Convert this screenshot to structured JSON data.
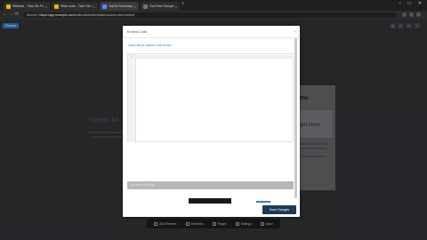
{
  "browser": {
    "tabs": [
      {
        "title": "Webinar - Twin Six Fu...",
        "color": "#f4b400",
        "active": false
      },
      {
        "title": "Slide code - Twin Six Fu...",
        "color": "#f4b400",
        "active": false
      },
      {
        "title": "TopTal Summary",
        "color": "#4a8cff",
        "active": true
      },
      {
        "title": "Our Free Sample HTML...",
        "color": "#777777",
        "active": false
      }
    ],
    "new_tab": "+",
    "window_controls": [
      "–",
      "□",
      "✕"
    ],
    "nav": {
      "back": "←",
      "forward": "→",
      "reload": "⟳"
    },
    "address": {
      "secure_label": "Secure",
      "host": "https://app.example.com",
      "path": "/editor/slides/template/custom-html-embed"
    }
  },
  "app": {
    "left_button": "Preview",
    "top_icons": [
      "gear-icon",
      "undo-icon",
      "redo-icon",
      "help-icon"
    ],
    "background_heading": "Signup! bo",
    "card": {
      "title": "ttle",
      "subtitle": "get Here"
    },
    "bottom_bar": [
      {
        "label": "Add Element",
        "icon": "add-element-icon"
      },
      {
        "label": "Elements",
        "icon": "elements-icon"
      },
      {
        "label": "Pages",
        "icon": "pages-icon"
      },
      {
        "label": "Settings",
        "icon": "settings-icon"
      },
      {
        "label": "Save",
        "icon": "save-icon"
      }
    ]
  },
  "modal": {
    "title": "Embed Code",
    "close": "×",
    "link_text": "Learn about custom code blocks",
    "editor": {
      "line_number": "1",
      "content": ""
    },
    "gray_bar_label": "Advanced Settings",
    "primary_button": "Save Changes",
    "colors": {
      "accent": "#3d7fc1",
      "button": "#1c3b57"
    }
  }
}
